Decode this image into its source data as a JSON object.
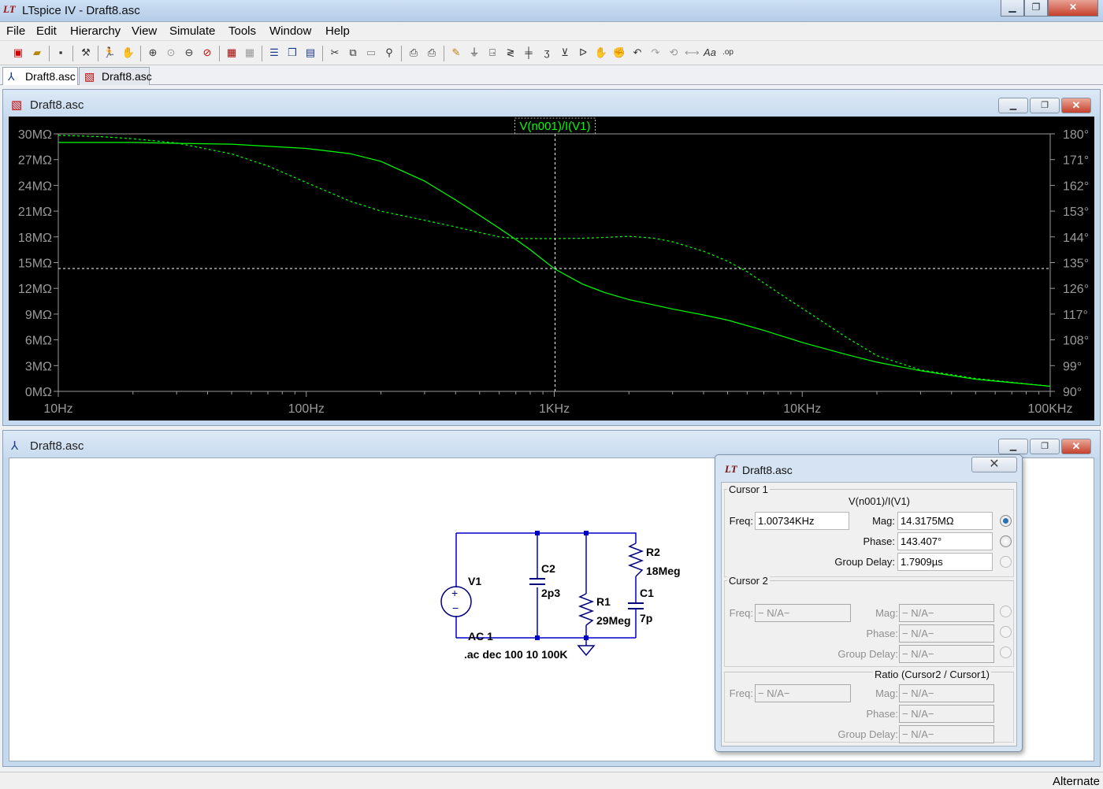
{
  "window": {
    "title": "LTspice IV - Draft8.asc",
    "app_icon": "LT"
  },
  "menu": [
    "File",
    "Edit",
    "Hierarchy",
    "View",
    "Simulate",
    "Tools",
    "Window",
    "Help"
  ],
  "tabs": [
    {
      "label": "Draft8.asc",
      "icon": "schematic-icon"
    },
    {
      "label": "Draft8.asc",
      "icon": "waveform-icon"
    }
  ],
  "plot_window": {
    "title": "Draft8.asc",
    "trace_label": "V(n001)/I(V1)"
  },
  "schematic_window": {
    "title": "Draft8.asc"
  },
  "chart_data": {
    "type": "line",
    "title": "V(n001)/I(V1)",
    "x_scale": "log",
    "xlim": [
      10,
      100000
    ],
    "xticks": [
      "10Hz",
      "100Hz",
      "1KHz",
      "10KHz",
      "100KHz"
    ],
    "ylim_left": [
      0,
      30
    ],
    "yticks_left": [
      "30MΩ",
      "27MΩ",
      "24MΩ",
      "21MΩ",
      "18MΩ",
      "15MΩ",
      "12MΩ",
      "9MΩ",
      "6MΩ",
      "3MΩ",
      "0MΩ"
    ],
    "ylim_right": [
      90,
      180
    ],
    "yticks_right": [
      "180°",
      "171°",
      "162°",
      "153°",
      "144°",
      "135°",
      "126°",
      "117°",
      "108°",
      "99°",
      "90°"
    ],
    "trace_color": "#00ff00",
    "background": "#000000",
    "series": [
      {
        "kind": "magnitude_MOhm",
        "style": "solid",
        "x": [
          10,
          20,
          30,
          50,
          100,
          150,
          200,
          300,
          400,
          500,
          600,
          700,
          800,
          1000,
          1300,
          1600,
          2000,
          3000,
          4000,
          5000,
          7000,
          10000,
          15000,
          20000,
          30000,
          50000,
          100000
        ],
        "y": [
          29.0,
          29.0,
          28.9,
          28.8,
          28.3,
          27.7,
          26.8,
          24.5,
          22.3,
          20.5,
          19.0,
          17.7,
          16.5,
          14.3,
          12.5,
          11.5,
          10.7,
          9.6,
          8.9,
          8.3,
          7.1,
          5.7,
          4.3,
          3.4,
          2.4,
          1.4,
          0.6
        ]
      },
      {
        "kind": "phase_deg",
        "style": "dashed",
        "x": [
          10,
          15,
          20,
          30,
          50,
          70,
          100,
          150,
          200,
          300,
          400,
          500,
          600,
          700,
          800,
          1000,
          1300,
          1600,
          2000,
          2500,
          3000,
          4000,
          5000,
          6000,
          8000,
          10000,
          15000,
          20000,
          30000,
          50000,
          100000
        ],
        "y": [
          179.5,
          179.0,
          178.3,
          176.8,
          173.0,
          168.8,
          163.0,
          156.5,
          153.0,
          149.8,
          147.5,
          145.5,
          144.0,
          143.5,
          143.4,
          143.4,
          143.5,
          143.8,
          144.2,
          143.6,
          142.3,
          139.0,
          135.5,
          131.8,
          124.5,
          119.0,
          109.0,
          102.5,
          97.5,
          94.5,
          91.8
        ]
      }
    ],
    "cursor": {
      "x": 1007.34,
      "y_mag": 14.3175,
      "y_phase": 143.407
    }
  },
  "schematic": {
    "components": {
      "V1": "V1",
      "V1_value": "AC 1",
      "C2": "C2",
      "C2_value": "2p3",
      "R1": "R1",
      "R1_value": "29Meg",
      "R2": "R2",
      "R2_value": "18Meg",
      "C1": "C1",
      "C1_value": "7p"
    },
    "directive": ".ac dec 100 10 100K",
    "wire_color": "#0000cc"
  },
  "cursor_dialog": {
    "title": "Draft8.asc",
    "cursor1": {
      "group": "Cursor 1",
      "trace": "V(n001)/I(V1)",
      "freq_label": "Freq:",
      "freq": "1.00734KHz",
      "mag_label": "Mag:",
      "mag": "14.3175MΩ",
      "phase_label": "Phase:",
      "phase": "143.407°",
      "gd_label": "Group Delay:",
      "gd": "1.7909µs"
    },
    "cursor2": {
      "group": "Cursor 2",
      "freq_label": "Freq:",
      "freq": "− N/A−",
      "mag_label": "Mag:",
      "mag": "− N/A−",
      "phase_label": "Phase:",
      "phase": "− N/A−",
      "gd_label": "Group Delay:",
      "gd": "− N/A−"
    },
    "ratio": {
      "title": "Ratio (Cursor2 / Cursor1)",
      "freq_label": "Freq:",
      "freq": "− N/A−",
      "mag_label": "Mag:",
      "mag": "− N/A−",
      "phase_label": "Phase:",
      "phase": "− N/A−",
      "gd_label": "Group Delay:",
      "gd": "− N/A−"
    }
  },
  "status": "Alternate"
}
